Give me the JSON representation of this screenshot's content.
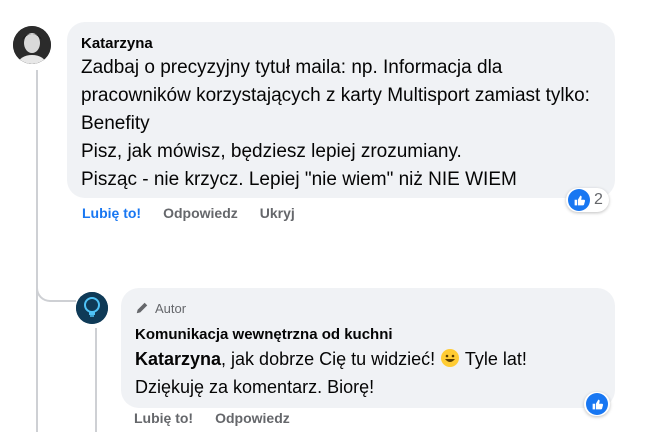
{
  "comment": {
    "author": "Katarzyna",
    "lines": [
      "Zadbaj o precyzyjny tytuł maila: np. Informacja dla pracowników korzystających z karty Multisport zamiast tylko: Benefity",
      "Pisz, jak mówisz, będziesz lepiej zrozumiany.",
      "Pisząc - nie krzycz. Lepiej \"nie wiem\" niż NIE WIEM"
    ],
    "actions": {
      "like": "Lubię to!",
      "reply": "Odpowiedz",
      "hide": "Ukryj"
    },
    "reaction_count": "2"
  },
  "reply": {
    "badge": "Autor",
    "author": "Komunikacja wewnętrzna od kuchni",
    "mention": "Katarzyna",
    "text_after_mention": ", jak dobrze Cię tu widzieć! ",
    "text_after_emoji": " Tyle lat!",
    "line2": "Dziękuję za komentarz. Biorę!",
    "actions": {
      "like": "Lubię to!",
      "reply": "Odpowiedz"
    }
  },
  "colors": {
    "accent": "#1877f2",
    "bubble": "#f0f2f5",
    "muted": "#65676b"
  }
}
